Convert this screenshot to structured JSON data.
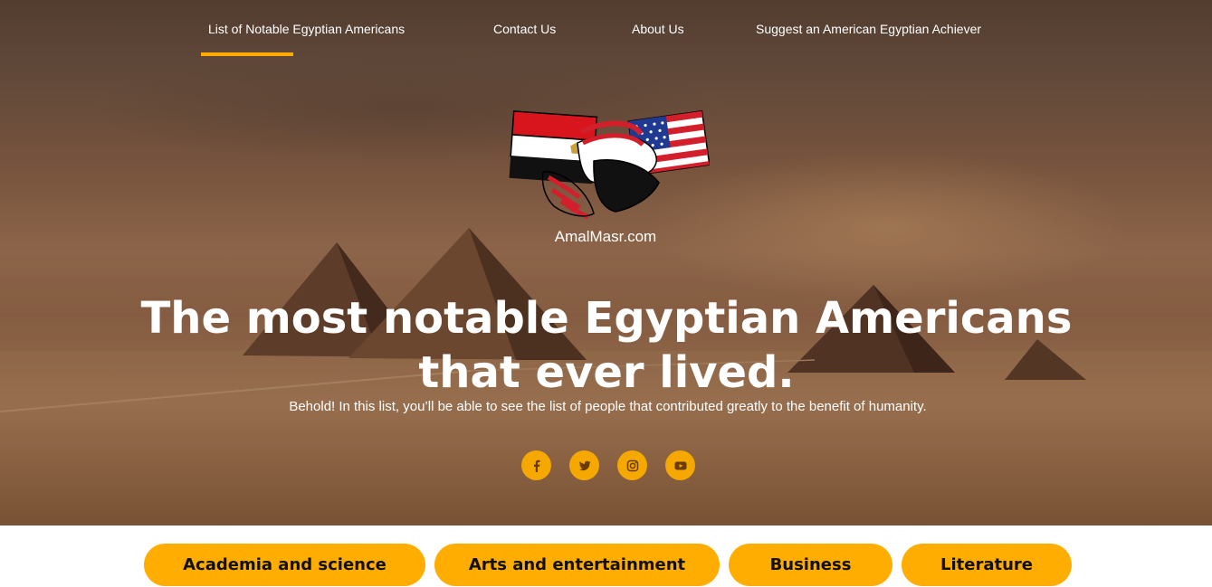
{
  "nav": {
    "items": [
      {
        "label": "List of Notable Egyptian Americans",
        "active": true
      },
      {
        "label": "Contact Us"
      },
      {
        "label": "About Us"
      },
      {
        "label": "Suggest an American Egyptian Achiever"
      }
    ],
    "accent": "#ffaa00"
  },
  "logo": {
    "text": "AmalMasr.com",
    "icon": "egypt-usa-handshake-flags"
  },
  "hero": {
    "title": "The most notable Egyptian Americans that ever lived.",
    "subtitle": "Behold! In this list, you’ll be able to see the list of people that contributed greatly to the benefit of humanity."
  },
  "socials": [
    {
      "name": "facebook-icon"
    },
    {
      "name": "twitter-icon"
    },
    {
      "name": "instagram-icon"
    },
    {
      "name": "youtube-icon"
    }
  ],
  "categories": [
    {
      "label": "Academia and science"
    },
    {
      "label": "Arts and entertainment"
    },
    {
      "label": "Business"
    },
    {
      "label": "Literature"
    }
  ],
  "colors": {
    "accent": "#ffad00",
    "social": "#f5a800"
  }
}
